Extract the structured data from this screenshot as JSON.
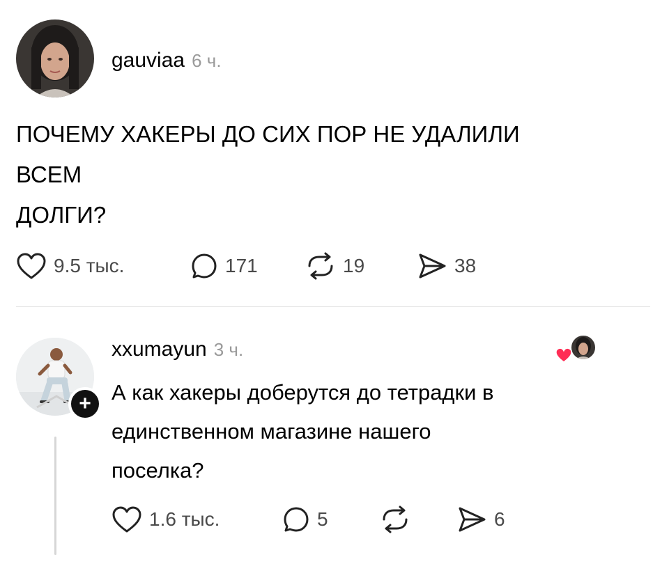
{
  "post": {
    "username": "gauviaa",
    "time": "6 ч.",
    "text_lines": [
      "ПОЧЕМУ ХАКЕРЫ ДО СИХ ПОР НЕ УДАЛИЛИ",
      "ВСЕМ",
      "ДОЛГИ?"
    ],
    "actions": {
      "likes": "9.5 тыс.",
      "comments": "171",
      "reposts": "19",
      "shares": "38"
    }
  },
  "reply": {
    "username": "xxumayun",
    "time": "3 ч.",
    "text_lines": [
      "А как хакеры доберутся до тетрадки в",
      "единственном магазине нашего",
      "поселка?"
    ],
    "follow_symbol": "+",
    "actions": {
      "likes": "1.6 тыс.",
      "comments": "5",
      "shares": "6"
    }
  },
  "icons": {
    "like": "heart-icon",
    "comment": "comment-bubble-icon",
    "repost": "repost-icon",
    "share": "share-arrow-icon",
    "liked_by_author": "heart-red-icon"
  },
  "colors": {
    "text": "#000000",
    "muted": "#9a9a9a",
    "action": "#4a4a4a",
    "heart_red": "#ff2d55",
    "divider": "#e3e3e3"
  }
}
